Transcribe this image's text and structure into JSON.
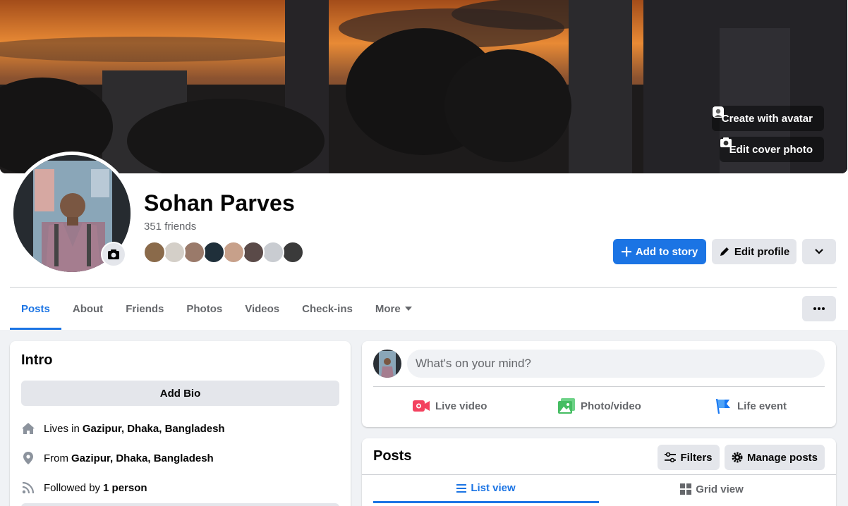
{
  "cover": {
    "create_avatar_label": "Create with avatar",
    "edit_cover_label": "Edit cover photo"
  },
  "profile": {
    "name": "Sohan Parves",
    "friends_count": "351 friends",
    "friend_avatar_colors": [
      "#8a6a4a",
      "#d4cfc8",
      "#9a7a6a",
      "#1f2f3a",
      "#c7a08a",
      "#5a4a48",
      "#c9ccd1",
      "#3a3a3a"
    ]
  },
  "actions": {
    "add_to_story": "Add to story",
    "edit_profile": "Edit profile"
  },
  "tabs": [
    {
      "label": "Posts",
      "active": true
    },
    {
      "label": "About"
    },
    {
      "label": "Friends"
    },
    {
      "label": "Photos"
    },
    {
      "label": "Videos"
    },
    {
      "label": "Check-ins"
    },
    {
      "label": "More"
    }
  ],
  "intro": {
    "title": "Intro",
    "add_bio": "Add Bio",
    "lives_prefix": "Lives in",
    "lives_value": "Gazipur, Dhaka, Bangladesh",
    "from_prefix": "From",
    "from_value": "Gazipur, Dhaka, Bangladesh",
    "followed_prefix": "Followed by",
    "followed_value": "1 person"
  },
  "composer": {
    "placeholder": "What's on your mind?",
    "live_video": "Live video",
    "photo_video": "Photo/video",
    "life_event": "Life event"
  },
  "posts": {
    "title": "Posts",
    "filters": "Filters",
    "manage_posts": "Manage posts",
    "list_view": "List view",
    "grid_view": "Grid view"
  },
  "colors": {
    "accent": "#1b74e4",
    "live_red": "#f3425f",
    "photo_green": "#45bd62",
    "life_blue": "#1877f2"
  }
}
